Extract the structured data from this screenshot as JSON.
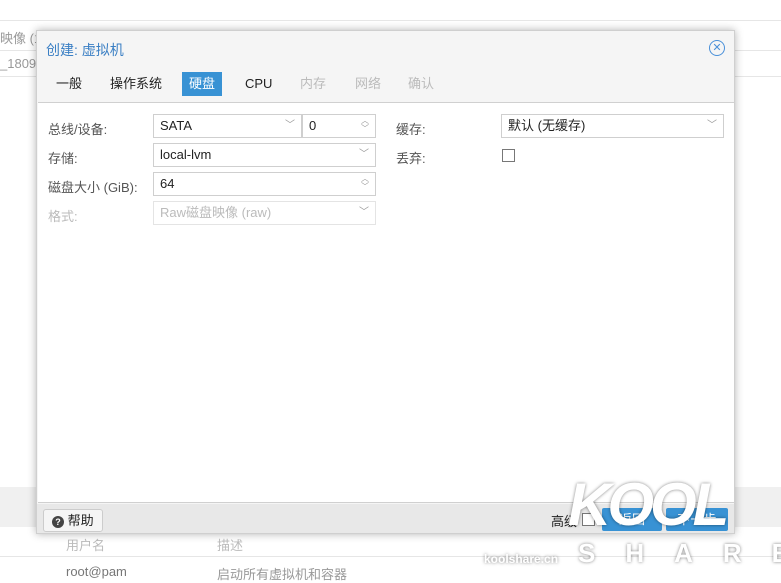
{
  "background": {
    "row1": "映像 (1",
    "row2": "_1809",
    "col_user": "用户名",
    "col_desc": "描述",
    "user": "root@pam",
    "desc": "启动所有虚拟机和容器"
  },
  "dialog": {
    "title": "创建: 虚拟机",
    "tabs": [
      {
        "label": "一般",
        "state": "normal"
      },
      {
        "label": "操作系统",
        "state": "normal"
      },
      {
        "label": "硬盘",
        "state": "active"
      },
      {
        "label": "CPU",
        "state": "normal"
      },
      {
        "label": "内存",
        "state": "disabled"
      },
      {
        "label": "网络",
        "state": "disabled"
      },
      {
        "label": "确认",
        "state": "disabled"
      }
    ],
    "form": {
      "bus_label": "总线/设备:",
      "bus_value": "SATA",
      "device_value": "0",
      "storage_label": "存储:",
      "storage_value": "local-lvm",
      "size_label": "磁盘大小 (GiB):",
      "size_value": "64",
      "format_label": "格式:",
      "format_value": "Raw磁盘映像 (raw)",
      "cache_label": "缓存:",
      "cache_value": "默认 (无缓存)",
      "discard_label": "丢弃:",
      "discard_checked": false
    },
    "footer": {
      "help": "帮助",
      "advanced": "高级",
      "back": "返回",
      "next": "下一步"
    }
  },
  "watermark": {
    "logo": "KOOL SHARE",
    "site": "koolshare.cn"
  }
}
